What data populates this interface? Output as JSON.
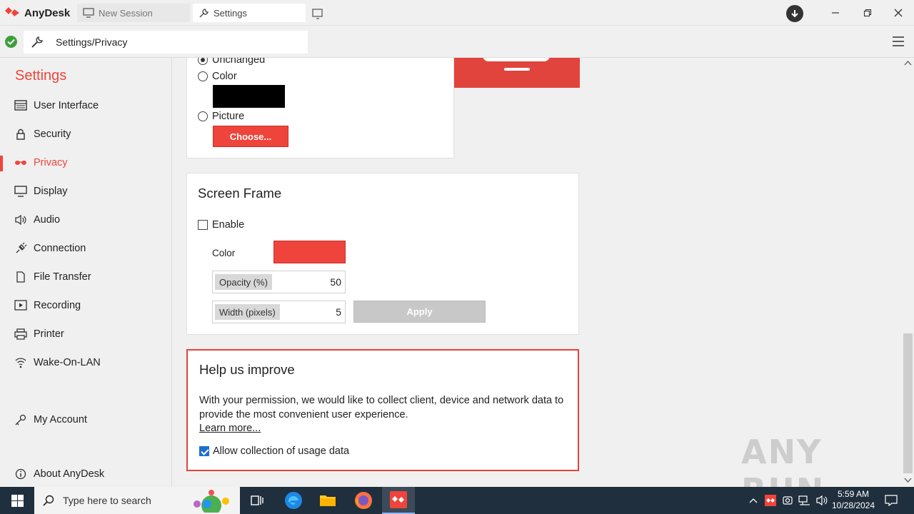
{
  "app": {
    "name": "AnyDesk"
  },
  "tabs": [
    {
      "label": "New Session"
    },
    {
      "label": "Settings"
    }
  ],
  "toolbar": {
    "address": "Settings/Privacy"
  },
  "sidebar": {
    "title": "Settings",
    "items": [
      {
        "label": "User Interface",
        "icon": "window-icon"
      },
      {
        "label": "Security",
        "icon": "lock-icon"
      },
      {
        "label": "Privacy",
        "icon": "glasses-icon",
        "active": true
      },
      {
        "label": "Display",
        "icon": "monitor-icon"
      },
      {
        "label": "Audio",
        "icon": "speaker-icon"
      },
      {
        "label": "Connection",
        "icon": "plug-icon"
      },
      {
        "label": "File Transfer",
        "icon": "file-icon"
      },
      {
        "label": "Recording",
        "icon": "play-icon"
      },
      {
        "label": "Printer",
        "icon": "printer-icon"
      },
      {
        "label": "Wake-On-LAN",
        "icon": "wifi-icon"
      }
    ],
    "bottom": [
      {
        "label": "My Account",
        "icon": "key-icon"
      },
      {
        "label": "About AnyDesk",
        "icon": "info-icon"
      }
    ]
  },
  "background": {
    "options": [
      {
        "label": "Unchanged",
        "selected": true
      },
      {
        "label": "Color",
        "selected": false
      },
      {
        "label": "Picture",
        "selected": false
      }
    ],
    "color_swatch": "#000000",
    "choose_label": "Choose..."
  },
  "screen_frame": {
    "title": "Screen Frame",
    "enable_label": "Enable",
    "enabled": false,
    "color_label": "Color",
    "color": "#ef443b",
    "opacity_label": "Opacity (%)",
    "opacity_value": "50",
    "width_label": "Width (pixels)",
    "width_value": "5",
    "apply_label": "Apply"
  },
  "help": {
    "title": "Help us improve",
    "text": "With your permission, we would like to collect client, device and network data to provide the most convenient user experience.",
    "learn_more": "Learn more...",
    "checkbox_label": "Allow collection of usage data",
    "checked": true
  },
  "watermark": "ANY RUN",
  "taskbar": {
    "search_placeholder": "Type here to search",
    "time": "5:59 AM",
    "date": "10/28/2024"
  },
  "colors": {
    "accent": "#ef443b",
    "taskbar": "#202f3d"
  }
}
